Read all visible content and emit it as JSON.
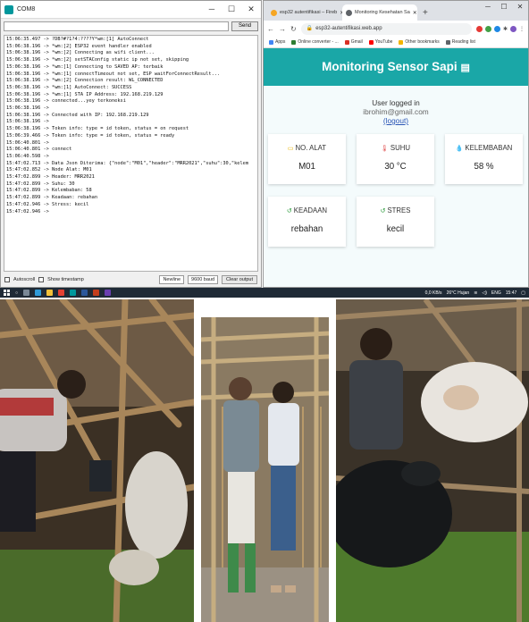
{
  "serial_monitor": {
    "title": "COM8",
    "send_label": "Send",
    "lines": [
      "15:06:35.497 -> ?DB?#?1?4:????Y*wm:[1] AutoConnect",
      "15:06:38.196 -> *wm:[2] ESP32 event handler enabled",
      "15:06:38.196 -> *wm:[2] Connecting as wifi client...",
      "15:06:38.196 -> *wm:[2] setSTAConfig static ip not set, skipping",
      "15:06:38.196 -> *wm:[1] Connecting to SAVED AP: terbaik",
      "15:06:38.196 -> *wm:[1] connectTimeout not set, ESP waitForConnectResult...",
      "15:06:38.196 -> *wm:[2] Connection result: WL_CONNECTED",
      "15:06:38.196 -> *wm:[1] AutoConnect: SUCCESS",
      "15:06:38.196 -> *wm:[1] STA IP Address: 192.168.219.129",
      "15:06:38.196 -> connected...yey terkoneksi",
      "15:06:38.196 ->",
      "15:06:38.196 -> Connected with IP: 192.168.219.129",
      "15:06:38.196 ->",
      "15:06:38.196 -> Token info: type = id token, status = on request",
      "15:06:39.466 -> Token info: type = id token, status = ready",
      "15:06:40.801 ->",
      "15:06:40.801 -> connect",
      "15:06:40.598 ->",
      "15:47:02.713 -> Data Json Diterima: {\"node\":\"M01\",\"header\":\"MRR2021\",\"suhu\":30,\"kelem",
      "15:47:02.852 -> Node Alat: M01",
      "15:47:02.899 -> Header: MRR2021",
      "15:47:02.899 -> Suhu: 30",
      "15:47:02.899 -> Kelembaban: 58",
      "15:47:02.899 -> Keadaan: rebahan",
      "15:47:02.946 -> Stress: kecil",
      "15:47:02.946 ->"
    ],
    "autoscroll_label": "Autoscroll",
    "timestamp_label": "Show timestamp",
    "line_ending": "Newline",
    "baud": "9600 baud",
    "clear_label": "Clear output"
  },
  "browser": {
    "tabs": [
      {
        "label": "esp32 autentifikasi – Fireb",
        "favicon_color": "#f6a623"
      },
      {
        "label": "Monitoring Kesehatan Sa",
        "favicon_color": "#5f6368"
      }
    ],
    "url": "esp32-autentifikasi.web.app",
    "bookmarks": [
      "Apps",
      "Online converter - ...",
      "Gmail",
      "YouTube",
      "Other bookmarks",
      "Reading list"
    ],
    "page": {
      "title": "Monitoring Sensor Sapi",
      "login_text": "User logged in",
      "email": "ibrohim@gmail.com",
      "logout_label": "(logout)",
      "cards": [
        {
          "label": "NO. ALAT",
          "value": "M01",
          "icon": "tag-icon",
          "icon_color": "#e8b400"
        },
        {
          "label": "SUHU",
          "value": "30 °C",
          "icon": "thermometer-icon",
          "icon_color": "#e05050"
        },
        {
          "label": "KELEMBABAN",
          "value": "58 %",
          "icon": "droplet-icon",
          "icon_color": "#2196f3"
        },
        {
          "label": "KEADAAN",
          "value": "rebahan",
          "icon": "history-icon",
          "icon_color": "#2a9a3a"
        },
        {
          "label": "STRES",
          "value": "kecil",
          "icon": "history-icon",
          "icon_color": "#2a9a3a"
        }
      ]
    }
  },
  "taskbar": {
    "network": "0,0 KB/s",
    "weather": "26°C Hujan",
    "language": "ENG",
    "time": "15:47"
  },
  "colors": {
    "header_teal": "#1aa7a7",
    "page_bg": "#f4fbfc"
  }
}
